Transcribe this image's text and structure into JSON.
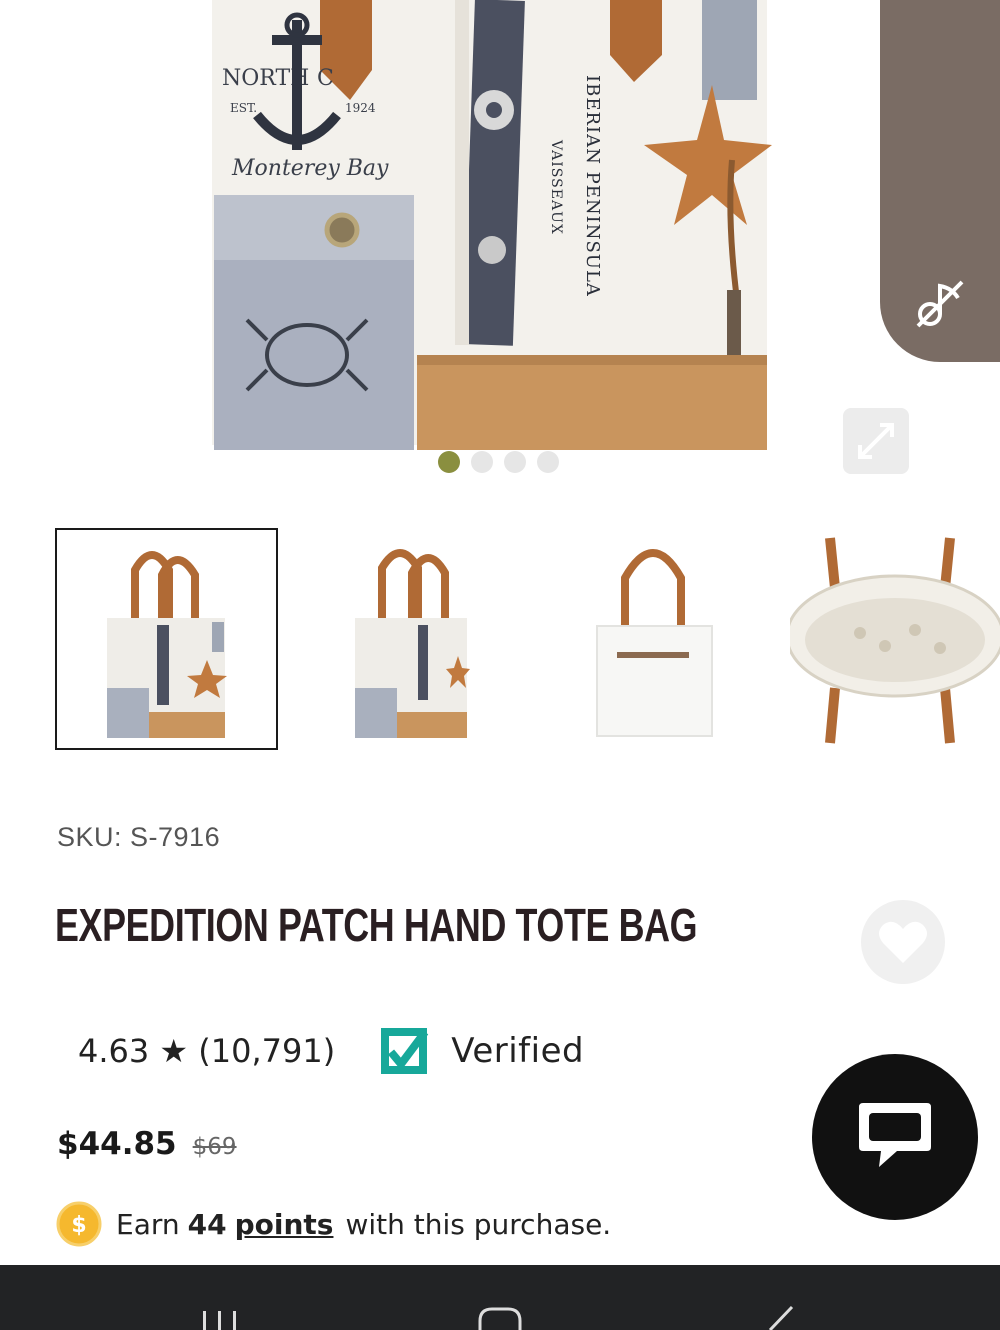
{
  "hero": {
    "print_text": "IBERIAN PENINSULA",
    "print_text_2": "VAISSEAUX",
    "carousel": {
      "count": 4,
      "active": 0
    }
  },
  "thumbnails": [
    {
      "name": "front-view",
      "selected": true
    },
    {
      "name": "angled-view",
      "selected": false
    },
    {
      "name": "back-view",
      "selected": false
    },
    {
      "name": "interior-view",
      "selected": false
    }
  ],
  "product": {
    "sku": "SKU: S-7916",
    "title": "EXPEDITION PATCH HAND TOTE BAG",
    "rating": "4.63 ★ (10,791)",
    "verified": "Verified",
    "price": "$44.85",
    "old_price": "$69"
  },
  "points": {
    "earn": "Earn",
    "amount": "44",
    "link": "points",
    "suffix": "with this purchase."
  },
  "icons": {
    "music": "music-off-icon",
    "expand": "expand-icon",
    "wishlist": "heart-icon",
    "chat": "chat-icon",
    "coin": "dollar-coin-icon",
    "verified": "verified-check-icon"
  },
  "colors": {
    "accent": "#8a8f3f",
    "music_tab": "#7a6c64",
    "title": "#2a1f22",
    "verified": "#17a89a",
    "coin": "#f5b82e"
  }
}
